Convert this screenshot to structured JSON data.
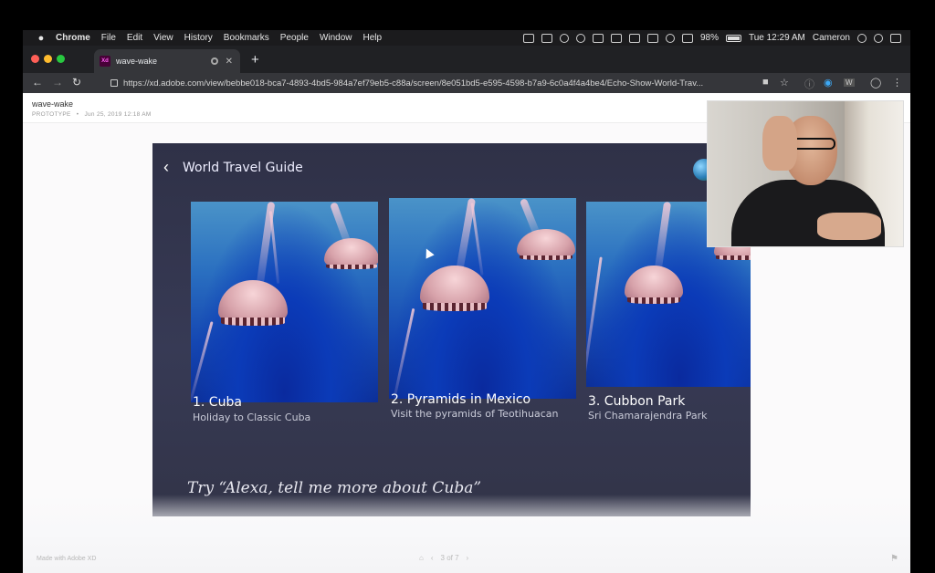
{
  "menubar": {
    "app": "Chrome",
    "items": [
      "File",
      "Edit",
      "View",
      "History",
      "Bookmarks",
      "People",
      "Window",
      "Help"
    ],
    "battery": "98%",
    "clock": "Tue 12:29 AM",
    "user": "Cameron"
  },
  "tab": {
    "favicon": "Xd",
    "title": "wave-wake"
  },
  "address": {
    "url": "https://xd.adobe.com/view/bebbe018-bca7-4893-4bd5-984a7ef79eb5-c88a/screen/8e051bd5-e595-4598-b7a9-6c0a4f4a4be4/Echo-Show-World-Trav..."
  },
  "toolbar_icons": {
    "profile_initial": "W"
  },
  "xd": {
    "project_name": "wave-wake",
    "type": "PROTOTYPE",
    "date": "Jun 25, 2019 12:18 AM",
    "made_with": "Made with Adobe XD",
    "pager": "3 of 7"
  },
  "artboard": {
    "title": "World Travel Guide",
    "hint": "Try “Alexa, tell me more about Cuba”",
    "cards": [
      {
        "name": "1. Cuba",
        "sub": "Holiday to Classic Cuba"
      },
      {
        "name": "2. Pyramids in Mexico",
        "sub": "Visit the pyramids of Teotihuacan"
      },
      {
        "name": "3. Cubbon Park",
        "sub": "Sri Chamarajendra Park"
      }
    ]
  },
  "colors": {
    "artboard_bg": "#34364e",
    "chrome_dark": "#202124",
    "chrome_toolbar": "#35363a"
  }
}
